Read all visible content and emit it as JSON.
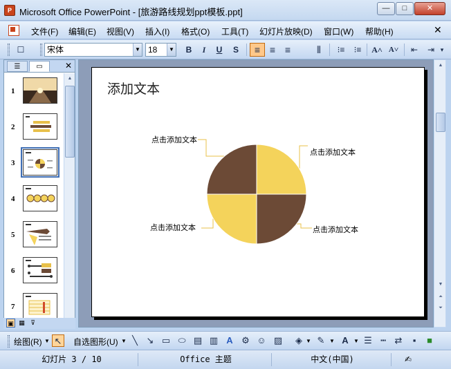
{
  "window": {
    "title": "Microsoft Office PowerPoint - [旅游路线规划ppt模板.ppt]",
    "app_icon": "powerpoint-icon",
    "controls": {
      "minimize": "—",
      "maximize": "□",
      "close": "✕"
    }
  },
  "menubar": {
    "items": [
      "文件(F)",
      "编辑(E)",
      "视图(V)",
      "插入(I)",
      "格式(O)",
      "工具(T)",
      "幻灯片放映(D)",
      "窗口(W)",
      "帮助(H)"
    ],
    "close": "✕"
  },
  "toolbar": {
    "font_name": "宋体",
    "font_size": "18",
    "bold": "B",
    "italic": "I",
    "underline": "U",
    "shadow": "S",
    "align_left": "≡",
    "align_center": "≡",
    "align_right": "≡",
    "distribute": "⫴",
    "numbering": "⁝≡",
    "bullets": "⁝≡",
    "increase_font": "A˄",
    "decrease_font": "A˅",
    "decrease_indent": "⇤",
    "increase_indent": "⇥"
  },
  "left_pane": {
    "tab_outline_icon": "outline-icon",
    "tab_slides_icon": "slides-icon",
    "close": "✕",
    "slides": [
      {
        "number": "1"
      },
      {
        "number": "2"
      },
      {
        "number": "3",
        "selected": true
      },
      {
        "number": "4"
      },
      {
        "number": "5"
      },
      {
        "number": "6"
      },
      {
        "number": "7"
      }
    ]
  },
  "slide": {
    "title": "添加文本",
    "callouts": {
      "top_left": "点击添加文本",
      "top_right": "点击添加文本",
      "bottom_left": "点击添加文本",
      "bottom_right": "点击添加文本"
    }
  },
  "chart_data": {
    "type": "pie",
    "values": [
      25,
      25,
      25,
      25
    ],
    "colors": [
      "#f4d35b",
      "#6c4a36",
      "#f4d35b",
      "#6c4a36"
    ],
    "title": ""
  },
  "colors": {
    "pie_yellow": "#f4d35b",
    "pie_brown": "#6c4a36",
    "callout_line": "#e8c04a"
  },
  "drawbar": {
    "draw_label": "绘图(R)",
    "autoshapes_label": "自选图形(U)"
  },
  "statusbar": {
    "slide_info": "幻灯片 3 / 10",
    "theme": "Office 主题",
    "language": "中文(中国)"
  }
}
